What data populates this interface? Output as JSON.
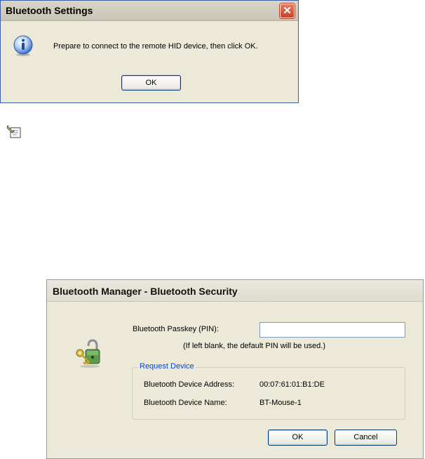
{
  "settings_dialog": {
    "title": "Bluetooth Settings",
    "close_icon": "close-icon",
    "info_icon": "information-icon",
    "message": "Prepare to connect to the remote HID device, then click OK.",
    "ok_label": "OK"
  },
  "note_icon": "note-pencil-icon",
  "security_dialog": {
    "title": "Bluetooth Manager - Bluetooth Security",
    "icon": "lock-key-icon",
    "passkey_label": "Bluetooth Passkey (PIN):",
    "passkey_value": "",
    "hint": "(If left blank, the default PIN will be used.)",
    "group": {
      "legend": "Request Device",
      "address_label": "Bluetooth Device Address:",
      "address_value": "00:07:61:01:B1:DE",
      "name_label": "Bluetooth Device Name:",
      "name_value": "BT-Mouse-1"
    },
    "ok_label": "OK",
    "cancel_label": "Cancel"
  },
  "colors": {
    "dialog_bg": "#ece9d8",
    "close_button": "#d2533a",
    "group_legend": "#0046d5",
    "button_border": "#003c74"
  }
}
